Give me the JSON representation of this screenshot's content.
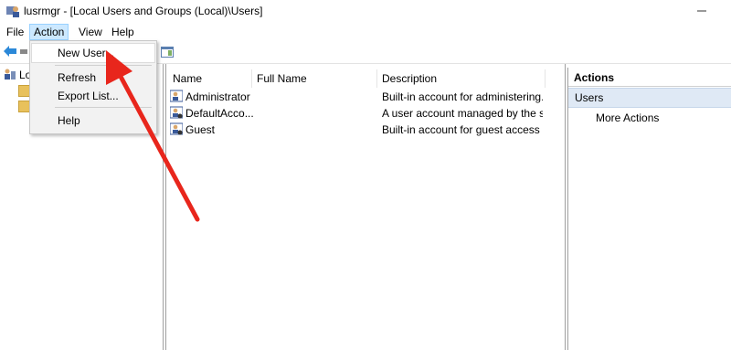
{
  "window": {
    "title": "lusrmgr - [Local Users and Groups (Local)\\Users]"
  },
  "menubar": {
    "items": [
      "File",
      "Action",
      "View",
      "Help"
    ]
  },
  "action_menu": {
    "items": [
      "New User...",
      "Refresh",
      "Export List...",
      "Help"
    ]
  },
  "tree": {
    "root_label": "Loca"
  },
  "list": {
    "columns": [
      "Name",
      "Full Name",
      "Description"
    ],
    "rows": [
      {
        "name": "Administrator",
        "full_name": "",
        "description": "Built-in account for administering..."
      },
      {
        "name": "DefaultAcco...",
        "full_name": "",
        "description": "A user account managed by the s..."
      },
      {
        "name": "Guest",
        "full_name": "",
        "description": "Built-in account for guest access t..."
      }
    ]
  },
  "actions": {
    "title": "Actions",
    "section": "Users",
    "more": "More Actions"
  },
  "colors": {
    "menu_highlight": "#cce8ff",
    "actions_section": "#dfe9f5",
    "annotation_arrow": "#e8261c"
  }
}
